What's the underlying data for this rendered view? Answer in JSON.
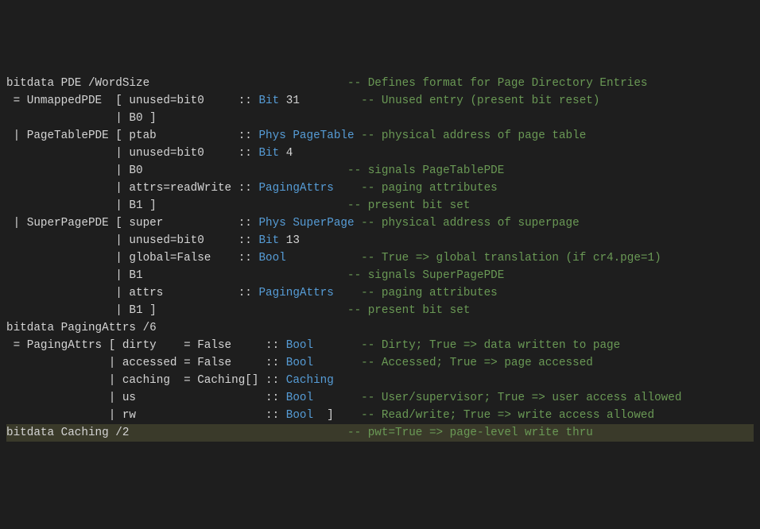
{
  "lines": [
    {
      "segs": [
        {
          "t": "bitdata PDE /WordSize                             ",
          "c": "pl"
        },
        {
          "t": "-- Defines format for Page Directory Entries",
          "c": "cm"
        }
      ]
    },
    {
      "segs": [
        {
          "t": " = UnmappedPDE  [ unused=bit0     :: ",
          "c": "pl"
        },
        {
          "t": "Bit",
          "c": "kw"
        },
        {
          "t": " 31         ",
          "c": "pl"
        },
        {
          "t": "-- Unused entry (present bit reset)",
          "c": "cm"
        }
      ]
    },
    {
      "segs": [
        {
          "t": "                | B0 ]",
          "c": "pl"
        }
      ]
    },
    {
      "segs": [
        {
          "t": " | PageTablePDE [ ptab            :: ",
          "c": "pl"
        },
        {
          "t": "Phys PageTable",
          "c": "kw"
        },
        {
          "t": " ",
          "c": "pl"
        },
        {
          "t": "-- physical address of page table",
          "c": "cm"
        }
      ]
    },
    {
      "segs": [
        {
          "t": "                | unused=bit0     :: ",
          "c": "pl"
        },
        {
          "t": "Bit",
          "c": "kw"
        },
        {
          "t": " 4",
          "c": "pl"
        }
      ]
    },
    {
      "segs": [
        {
          "t": "                | B0                              ",
          "c": "pl"
        },
        {
          "t": "-- signals PageTablePDE",
          "c": "cm"
        }
      ]
    },
    {
      "segs": [
        {
          "t": "                | attrs=readWrite :: ",
          "c": "pl"
        },
        {
          "t": "PagingAttrs",
          "c": "kw"
        },
        {
          "t": "    ",
          "c": "pl"
        },
        {
          "t": "-- paging attributes",
          "c": "cm"
        }
      ]
    },
    {
      "segs": [
        {
          "t": "                | B1 ]                            ",
          "c": "pl"
        },
        {
          "t": "-- present bit set",
          "c": "cm"
        }
      ]
    },
    {
      "segs": [
        {
          "t": " | SuperPagePDE [ super           :: ",
          "c": "pl"
        },
        {
          "t": "Phys SuperPage",
          "c": "kw"
        },
        {
          "t": " ",
          "c": "pl"
        },
        {
          "t": "-- physical address of superpage",
          "c": "cm"
        }
      ]
    },
    {
      "segs": [
        {
          "t": "                | unused=bit0     :: ",
          "c": "pl"
        },
        {
          "t": "Bit",
          "c": "kw"
        },
        {
          "t": " 13",
          "c": "pl"
        }
      ]
    },
    {
      "segs": [
        {
          "t": "                | global=False    :: ",
          "c": "pl"
        },
        {
          "t": "Bool",
          "c": "kw"
        },
        {
          "t": "           ",
          "c": "pl"
        },
        {
          "t": "-- True => global translation (if cr4.pge=1)",
          "c": "cm"
        }
      ]
    },
    {
      "segs": [
        {
          "t": "                | B1                              ",
          "c": "pl"
        },
        {
          "t": "-- signals SuperPagePDE",
          "c": "cm"
        }
      ]
    },
    {
      "segs": [
        {
          "t": "                | attrs           :: ",
          "c": "pl"
        },
        {
          "t": "PagingAttrs",
          "c": "kw"
        },
        {
          "t": "    ",
          "c": "pl"
        },
        {
          "t": "-- paging attributes",
          "c": "cm"
        }
      ]
    },
    {
      "segs": [
        {
          "t": "                | B1 ]                            ",
          "c": "pl"
        },
        {
          "t": "-- present bit set",
          "c": "cm"
        }
      ]
    },
    {
      "segs": [
        {
          "t": "",
          "c": "pl"
        }
      ]
    },
    {
      "segs": [
        {
          "t": "bitdata PagingAttrs /6",
          "c": "pl"
        }
      ]
    },
    {
      "segs": [
        {
          "t": " = PagingAttrs [ dirty    = False     :: ",
          "c": "pl"
        },
        {
          "t": "Bool",
          "c": "kw"
        },
        {
          "t": "       ",
          "c": "pl"
        },
        {
          "t": "-- Dirty; True => data written to page",
          "c": "cm"
        }
      ]
    },
    {
      "segs": [
        {
          "t": "               | accessed = False     :: ",
          "c": "pl"
        },
        {
          "t": "Bool",
          "c": "kw"
        },
        {
          "t": "       ",
          "c": "pl"
        },
        {
          "t": "-- Accessed; True => page accessed",
          "c": "cm"
        }
      ]
    },
    {
      "segs": [
        {
          "t": "               | caching  = Caching[] :: ",
          "c": "pl"
        },
        {
          "t": "Caching",
          "c": "kw"
        }
      ]
    },
    {
      "segs": [
        {
          "t": "               | us                   :: ",
          "c": "pl"
        },
        {
          "t": "Bool",
          "c": "kw"
        },
        {
          "t": "       ",
          "c": "pl"
        },
        {
          "t": "-- User/supervisor; True => user access allowed",
          "c": "cm"
        }
      ]
    },
    {
      "segs": [
        {
          "t": "               | rw                   :: ",
          "c": "pl"
        },
        {
          "t": "Bool",
          "c": "kw"
        },
        {
          "t": "  ]    ",
          "c": "pl"
        },
        {
          "t": "-- Read/write; True => write access allowed",
          "c": "cm"
        }
      ]
    },
    {
      "segs": [
        {
          "t": "",
          "c": "pl"
        }
      ]
    },
    {
      "segs": [
        {
          "t": "bitdata Caching /2                                ",
          "c": "pl"
        },
        {
          "t": "-- pwt=True => page-level write thru",
          "c": "cm"
        }
      ],
      "hl": true
    }
  ]
}
